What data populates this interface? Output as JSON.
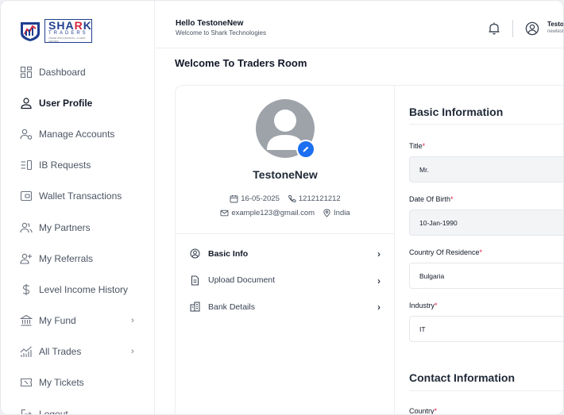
{
  "brand": {
    "name_main": "SHA",
    "name_accent": "R",
    "name_end": "K",
    "sub": "TRADERS",
    "tagline": "TRADE WITH PASSION + CLIENT CENTRIC"
  },
  "sidebar": {
    "items": [
      {
        "label": "Dashboard",
        "icon": "dashboard-icon",
        "active": false
      },
      {
        "label": "User Profile",
        "icon": "user-icon",
        "active": true
      },
      {
        "label": "Manage Accounts",
        "icon": "users-gear-icon",
        "active": false
      },
      {
        "label": "IB Requests",
        "icon": "list-icon",
        "active": false
      },
      {
        "label": "Wallet Transactions",
        "icon": "wallet-icon",
        "active": false
      },
      {
        "label": "My Partners",
        "icon": "partners-icon",
        "active": false
      },
      {
        "label": "My Referrals",
        "icon": "user-plus-icon",
        "active": false
      },
      {
        "label": "Level Income History",
        "icon": "dollar-icon",
        "active": false
      },
      {
        "label": "My Fund",
        "icon": "bank-icon",
        "active": false,
        "chevron": true
      },
      {
        "label": "All Trades",
        "icon": "chart-icon",
        "active": false,
        "chevron": true
      },
      {
        "label": "My Tickets",
        "icon": "ticket-icon",
        "active": false
      },
      {
        "label": "Logout",
        "icon": "logout-icon",
        "active": false
      }
    ]
  },
  "header": {
    "greeting": "Hello TestoneNew",
    "subtitle": "Welcome to Shark Technologies",
    "user_name": "TestoneNew",
    "user_email": "newtest@gmail.com"
  },
  "page": {
    "title": "Welcome To Traders Room"
  },
  "profile": {
    "name": "TestoneNew",
    "date": "16-05-2025",
    "phone": "1212121212",
    "email": "example123@gmail.com",
    "country": "India",
    "menu": [
      {
        "label": "Basic Info",
        "icon": "user-circle-icon",
        "active": true
      },
      {
        "label": "Upload Document",
        "icon": "document-icon",
        "active": false
      },
      {
        "label": "Bank Details",
        "icon": "building-icon",
        "active": false
      }
    ]
  },
  "basic_info": {
    "title": "Basic Information",
    "fields": [
      {
        "label": "Title",
        "value": "Mr."
      },
      {
        "label": "Date Of Birth",
        "value": "10-Jan-1990"
      },
      {
        "label": "Country Of Residence",
        "value": "Bulgaria"
      },
      {
        "label": "Industry",
        "value": "IT"
      }
    ]
  },
  "contact_info": {
    "title": "Contact Information",
    "fields": [
      {
        "label": "Country"
      }
    ]
  },
  "colors": {
    "accent": "#1d6ff2",
    "required": "#e11d48",
    "brand_blue": "#1f3f8f",
    "brand_red": "#d7263d"
  }
}
